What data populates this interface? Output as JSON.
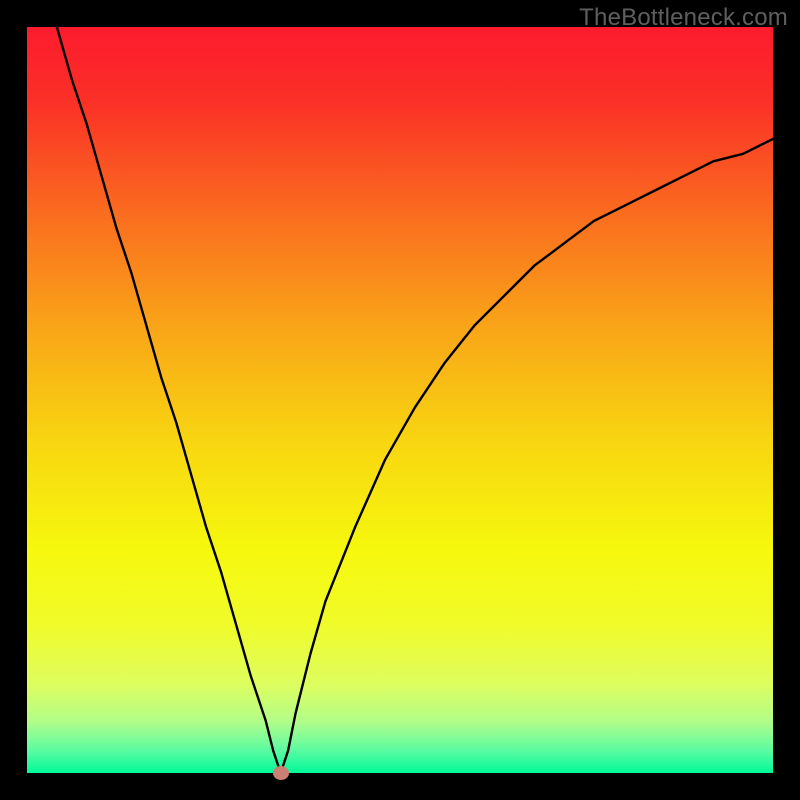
{
  "watermark": "TheBottleneck.com",
  "colors": {
    "gradient_stops": [
      {
        "offset": 0.0,
        "color": "#fc1b2d"
      },
      {
        "offset": 0.1,
        "color": "#fb3027"
      },
      {
        "offset": 0.25,
        "color": "#fa6c1f"
      },
      {
        "offset": 0.4,
        "color": "#f9a418"
      },
      {
        "offset": 0.55,
        "color": "#f8d411"
      },
      {
        "offset": 0.7,
        "color": "#f6f80d"
      },
      {
        "offset": 0.8,
        "color": "#f0fb29"
      },
      {
        "offset": 0.88,
        "color": "#defd5e"
      },
      {
        "offset": 0.93,
        "color": "#b3fd88"
      },
      {
        "offset": 0.97,
        "color": "#5bfba1"
      },
      {
        "offset": 1.0,
        "color": "#00fa9a"
      }
    ],
    "curve": "#000000",
    "dot": "#cc8074",
    "frame": "#000000",
    "watermark_text": "#5f5f5f"
  },
  "chart_data": {
    "type": "line",
    "title": "",
    "xlabel": "",
    "ylabel": "",
    "xlim": [
      0,
      100
    ],
    "ylim": [
      0,
      100
    ],
    "grid": false,
    "legend": false,
    "series": [
      {
        "name": "bottleneck-curve",
        "x": [
          4,
          6,
          8,
          10,
          12,
          14,
          16,
          18,
          20,
          22,
          24,
          26,
          28,
          30,
          32,
          33,
          34,
          35,
          36,
          38,
          40,
          44,
          48,
          52,
          56,
          60,
          64,
          68,
          72,
          76,
          80,
          84,
          88,
          92,
          96,
          100
        ],
        "y": [
          100,
          93,
          87,
          80,
          73,
          67,
          60,
          53,
          47,
          40,
          33,
          27,
          20,
          13,
          7,
          3,
          0,
          3,
          8,
          16,
          23,
          33,
          42,
          49,
          55,
          60,
          64,
          68,
          71,
          74,
          76,
          78,
          80,
          82,
          83,
          85
        ]
      }
    ],
    "marker": {
      "x": 34,
      "y": 0,
      "color": "#cc8074"
    }
  }
}
